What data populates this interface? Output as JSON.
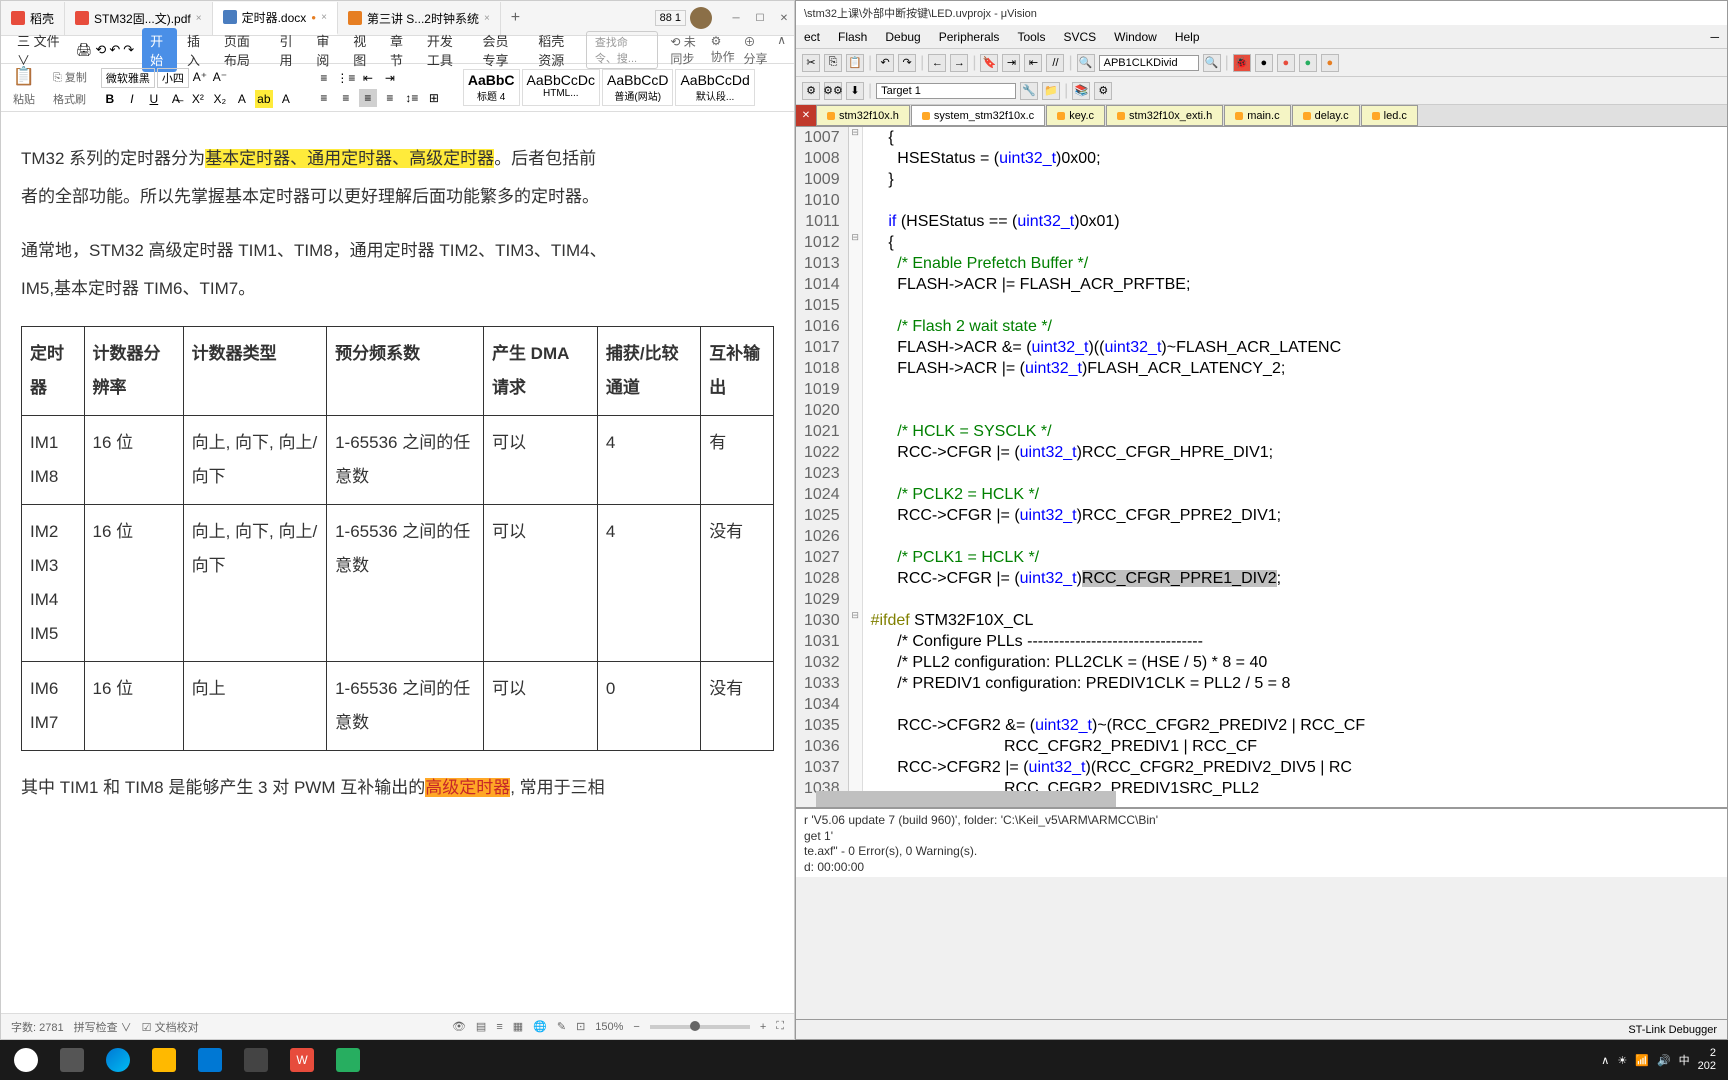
{
  "wps": {
    "tabs": [
      {
        "label": "稻壳",
        "icon": "red"
      },
      {
        "label": "STM32固...文).pdf",
        "icon": "red"
      },
      {
        "label": "定时器.docx",
        "icon": "blue",
        "active": true,
        "dot": "●"
      },
      {
        "label": "第三讲 S...2时钟系统",
        "icon": "orange"
      }
    ],
    "menu": [
      "三 文件 ∨"
    ],
    "menuItems": [
      "开始",
      "插入",
      "页面布局",
      "引用",
      "审阅",
      "视图",
      "章节",
      "开发工具",
      "会员专享",
      "稻壳资源"
    ],
    "searchPlaceholder": "查找命令、搜...",
    "rightMenu": [
      "⟲ 未同步",
      "⚙ 协作",
      "⊕ 分享"
    ],
    "toolbar": {
      "paste": "粘贴",
      "copy": "⎘ 复制",
      "formatBrush": "格式刷",
      "font": "微软雅黑",
      "fontSize": "小四",
      "styles": [
        {
          "sample": "AaBbC",
          "name": "标题 4"
        },
        {
          "sample": "AaBbCcDc",
          "name": "HTML..."
        },
        {
          "sample": "AaBbCcD",
          "name": "普通(网站)"
        },
        {
          "sample": "AaBbCcDd",
          "name": "默认段..."
        }
      ]
    },
    "doc": {
      "p1_a": "TM32 系列的定时器分为",
      "p1_hl": "基本定时器、通用定时器、高级定时器",
      "p1_b": "。后者包括前",
      "p2": "者的全部功能。所以先掌握基本定时器可以更好理解后面功能繁多的定时器。",
      "p3": "通常地，STM32 高级定时器 TIM1、TIM8，通用定时器 TIM2、TIM3、TIM4、",
      "p4": "IM5,基本定时器 TIM6、TIM7。",
      "headers": [
        "定时器",
        "计数器分辨率",
        "计数器类型",
        "预分频系数",
        "产生 DMA 请求",
        "捕获/比较通道",
        "互补输出"
      ],
      "rows": [
        [
          "IM1\nIM8",
          "16 位",
          "向上, 向下, 向上/向下",
          "1-65536 之间的任意数",
          "可以",
          "4",
          "有"
        ],
        [
          "IM2\nIM3\nIM4\nIM5",
          "16 位",
          "向上, 向下, 向上/向下",
          "1-65536 之间的任意数",
          "可以",
          "4",
          "没有"
        ],
        [
          "IM6\nIM7",
          "16 位",
          "向上",
          "1-65536 之间的任意数",
          "可以",
          "0",
          "没有"
        ]
      ],
      "p5_a": "其中 TIM1 和 TIM8 是能够产生 3 对 PWM 互补输出的",
      "p5_hl": "高级定时器",
      "p5_b": ", 常用于三相"
    },
    "status": {
      "wordcount": "字数: 2781",
      "spellcheck": "拼写检查 ∨",
      "docCheck": "☑ 文档校对",
      "zoom": "150%"
    }
  },
  "uv": {
    "title": "\\stm32上课\\外部中断按键\\LED.uvprojx - μVision",
    "menu": [
      "ect",
      "Flash",
      "Debug",
      "Peripherals",
      "Tools",
      "SVCS",
      "Window",
      "Help"
    ],
    "combo1": "APB1CLKDivid",
    "combo2": "Target 1",
    "tabs": [
      "stm32f10x.h",
      "system_stm32f10x.c",
      "key.c",
      "stm32f10x_exti.h",
      "main.c",
      "delay.c",
      "led.c"
    ],
    "activeTab": 1,
    "code": {
      "startLine": 1007,
      "lines": [
        "    {",
        "      HSEStatus = (uint32_t)0x00;",
        "    }",
        "",
        "    if (HSEStatus == (uint32_t)0x01)",
        "    {",
        "      /* Enable Prefetch Buffer */",
        "      FLASH->ACR |= FLASH_ACR_PRFTBE;",
        "",
        "      /* Flash 2 wait state */",
        "      FLASH->ACR &= (uint32_t)((uint32_t)~FLASH_ACR_LATENC",
        "      FLASH->ACR |= (uint32_t)FLASH_ACR_LATENCY_2;",
        "",
        "",
        "      /* HCLK = SYSCLK */",
        "      RCC->CFGR |= (uint32_t)RCC_CFGR_HPRE_DIV1;",
        "",
        "      /* PCLK2 = HCLK */",
        "      RCC->CFGR |= (uint32_t)RCC_CFGR_PPRE2_DIV1;",
        "",
        "      /* PCLK1 = HCLK */",
        "      RCC->CFGR |= (uint32_t)RCC_CFGR_PPRE1_DIV2;",
        "",
        "#ifdef STM32F10X_CL",
        "      /* Configure PLLs ---------------------------------",
        "      /* PLL2 configuration: PLL2CLK = (HSE / 5) * 8 = 40",
        "      /* PREDIV1 configuration: PREDIV1CLK = PLL2 / 5 = 8",
        "",
        "      RCC->CFGR2 &= (uint32_t)~(RCC_CFGR2_PREDIV2 | RCC_CF",
        "                              RCC_CFGR2_PREDIV1 | RCC_CF",
        "      RCC->CFGR2 |= (uint32_t)(RCC_CFGR2_PREDIV2_DIV5 | RC",
        "                              RCC_CFGR2_PREDIV1SRC_PLL2"
      ]
    },
    "output": [
      "r 'V5.06 update 7 (build 960)', folder: 'C:\\Keil_v5\\ARM\\ARMCC\\Bin'",
      "get 1'",
      "te.axf\" - 0 Error(s), 0 Warning(s).",
      "d:  00:00:00"
    ],
    "statusbar": "ST-Link Debugger"
  },
  "tray": {
    "items": [
      "∧",
      "☀",
      "📶",
      "🔊",
      "中"
    ],
    "time1": "2",
    "time2": "202"
  }
}
